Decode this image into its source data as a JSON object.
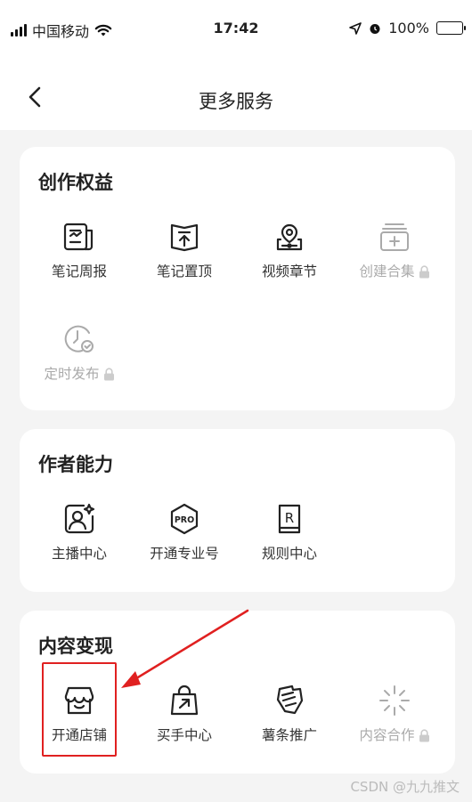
{
  "status_bar": {
    "carrier": "中国移动",
    "time": "17:42",
    "battery": "100%"
  },
  "nav": {
    "title": "更多服务"
  },
  "sections": [
    {
      "title": "创作权益",
      "items": [
        {
          "label": "笔记周报",
          "icon": "note-report-icon",
          "locked": false
        },
        {
          "label": "笔记置顶",
          "icon": "pin-top-icon",
          "locked": false
        },
        {
          "label": "视频章节",
          "icon": "video-chapter-icon",
          "locked": false
        },
        {
          "label": "创建合集",
          "icon": "create-collection-icon",
          "locked": true
        },
        {
          "label": "定时发布",
          "icon": "scheduled-publish-icon",
          "locked": true
        }
      ]
    },
    {
      "title": "作者能力",
      "items": [
        {
          "label": "主播中心",
          "icon": "streamer-center-icon",
          "locked": false
        },
        {
          "label": "开通专业号",
          "icon": "pro-account-icon",
          "locked": false
        },
        {
          "label": "规则中心",
          "icon": "rules-center-icon",
          "locked": false
        }
      ]
    },
    {
      "title": "内容变现",
      "items": [
        {
          "label": "开通店铺",
          "icon": "open-store-icon",
          "locked": false
        },
        {
          "label": "买手中心",
          "icon": "buyer-center-icon",
          "locked": false
        },
        {
          "label": "薯条推广",
          "icon": "promotion-icon",
          "locked": false
        },
        {
          "label": "内容合作",
          "icon": "content-cooperation-icon",
          "locked": true
        }
      ]
    }
  ],
  "watermark": "CSDN @九九推文",
  "colors": {
    "annotation_red": "#e02020",
    "disabled_gray": "#aaaaaa",
    "battery_green": "#4cd964"
  }
}
